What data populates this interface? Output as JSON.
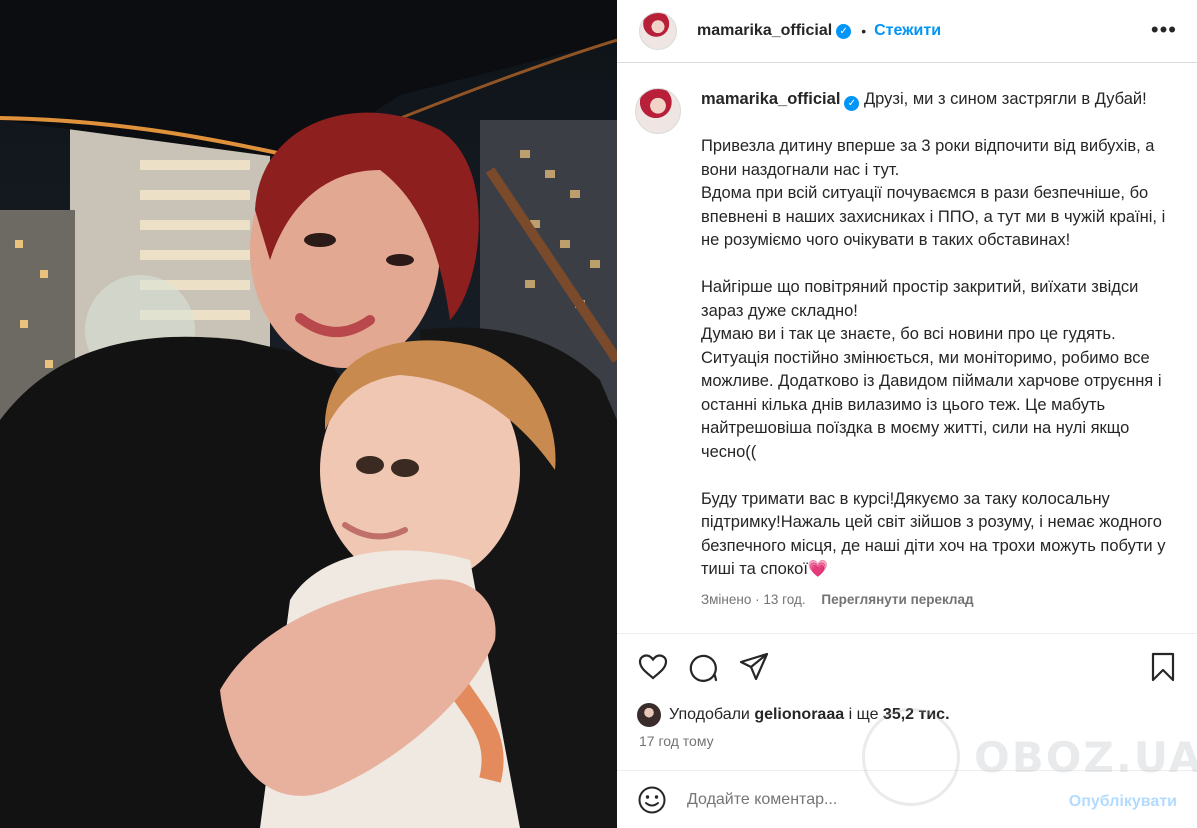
{
  "post": {
    "username": "mamarika_official",
    "follow_label": "Стежити",
    "more_label": "•••",
    "caption": "Друзі, ми з сином застрягли в Дубай!\n\nПривезла дитину вперше за 3 роки відпочити від вибухів, а вони наздогнали нас і тут.\nВдома при всій ситуації почуваємся в рази безпечніше, бо впевнені в наших захисниках і ППО, а тут ми в чужій країні, і не розуміємо чого очікувати в таких обставинах!\n\nНайгірше що повітряний простір закритий, виїхати звідси зараз дуже складно!\nДумаю ви і так це знаєте, бо всі новини про це гудять. Ситуація постійно змінюється, ми моніторимо, робимо все можливе. Додатково із Давидом піймали харчове отруєння і останні кілька днів вилазимо із цього теж. Це мабуть найтрешовіша поїздка в моєму житті, сили на нулі якщо чесно((\n\nБуду тримати вас в курсі!Дякуємо за таку колосальну підтримку!Нажаль цей світ зійшов з розуму, і немає жодного безпечного місця, де наші діти хоч на трохи можуть побути у тиші та спокої💗",
    "edited_label": "Змінено",
    "edited_time": "13 год.",
    "translate_label": "Переглянути переклад"
  },
  "likes": {
    "prefix": "Уподобали",
    "user": "gelionoraaa",
    "middle": "і ще",
    "count": "35,2 тис."
  },
  "timestamp": "17 год тому",
  "comment": {
    "placeholder": "Додайте коментар...",
    "publish_label": "Опублікувати"
  },
  "watermark": "OBOZ.UA",
  "colors": {
    "accent": "#0095f6",
    "publish_disabled": "#b3dbff",
    "muted": "#737373"
  }
}
